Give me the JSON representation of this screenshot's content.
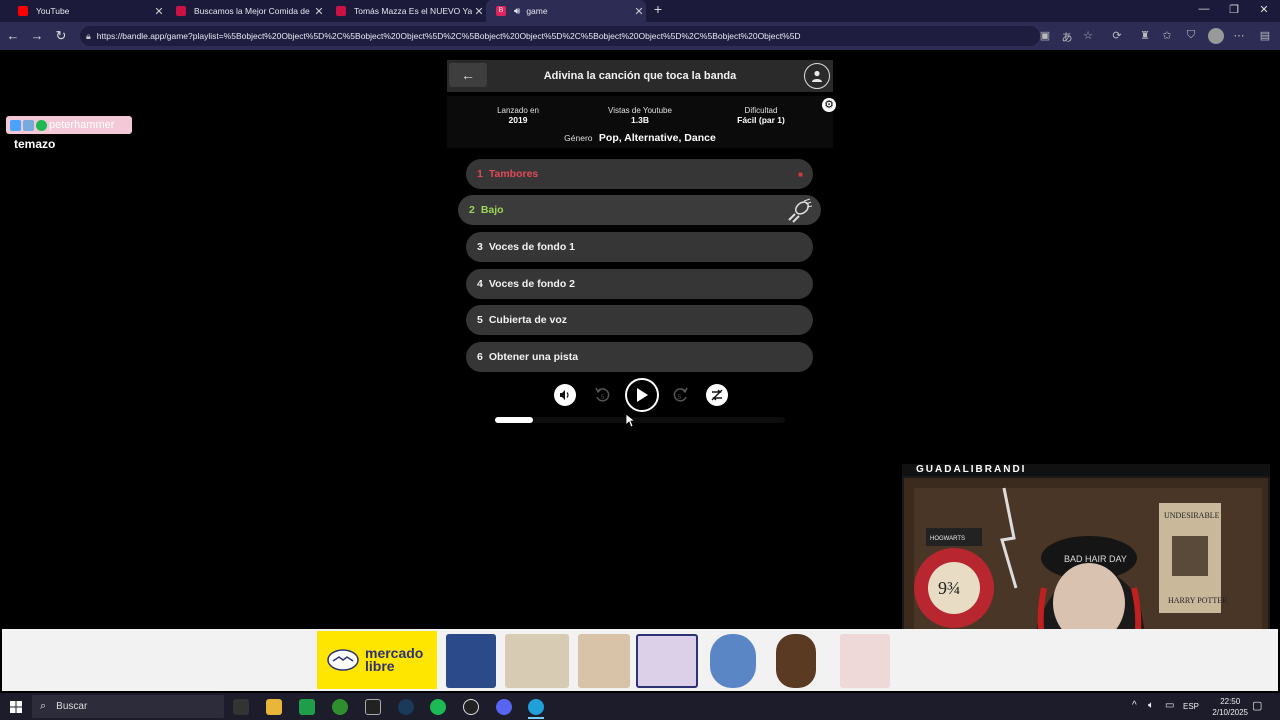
{
  "browser": {
    "tabs": [
      {
        "title": "YouTube",
        "color": "#ff0000"
      },
      {
        "title": "Buscamos la Mejor Comida de Es",
        "color": "#ff0033"
      },
      {
        "title": "Tomás Mazza Es el NUEVO Yao Ca",
        "color": "#ff0033"
      },
      {
        "title": "game",
        "color": "#e0245e"
      }
    ],
    "url": "https://bandle.app/game?playlist=%5Bobject%20Object%5D%2C%5Bobject%20Object%5D%2C%5Bobject%20Object%5D%2C%5Bobject%20Object%5D%2C%5Bobject%20Object%5D"
  },
  "game": {
    "title": "Adivina la canción que toca la banda",
    "info": {
      "released_label": "Lanzado en",
      "released_value": "2019",
      "views_label": "Vistas de Youtube",
      "views_value": "1.3B",
      "difficulty_label": "Dificultad",
      "difficulty_value": "Fácil (par 1)",
      "genre_label": "Género",
      "genre_value": "Pop, Alternative, Dance"
    },
    "tracks": [
      {
        "num": "1",
        "label": "Tambores",
        "state": "failed"
      },
      {
        "num": "2",
        "label": "Bajo",
        "state": "active"
      },
      {
        "num": "3",
        "label": "Voces de fondo 1",
        "state": "locked"
      },
      {
        "num": "4",
        "label": "Voces de fondo 2",
        "state": "locked"
      },
      {
        "num": "5",
        "label": "Cubierta de voz",
        "state": "locked"
      },
      {
        "num": "6",
        "label": "Obtener una pista",
        "state": "locked"
      }
    ],
    "progress": 0.13
  },
  "overlay": {
    "chat_user": "peterhammer",
    "chat_message": "temazo",
    "webcam_name": "GUADALIBRANDI"
  },
  "ad": {
    "brand": "mercado libre",
    "brand_line1": "mercado",
    "brand_line2": "libre"
  },
  "taskbar": {
    "search_placeholder": "Buscar",
    "lang": "ESP",
    "time": "22:50",
    "date": "2/10/2025"
  }
}
